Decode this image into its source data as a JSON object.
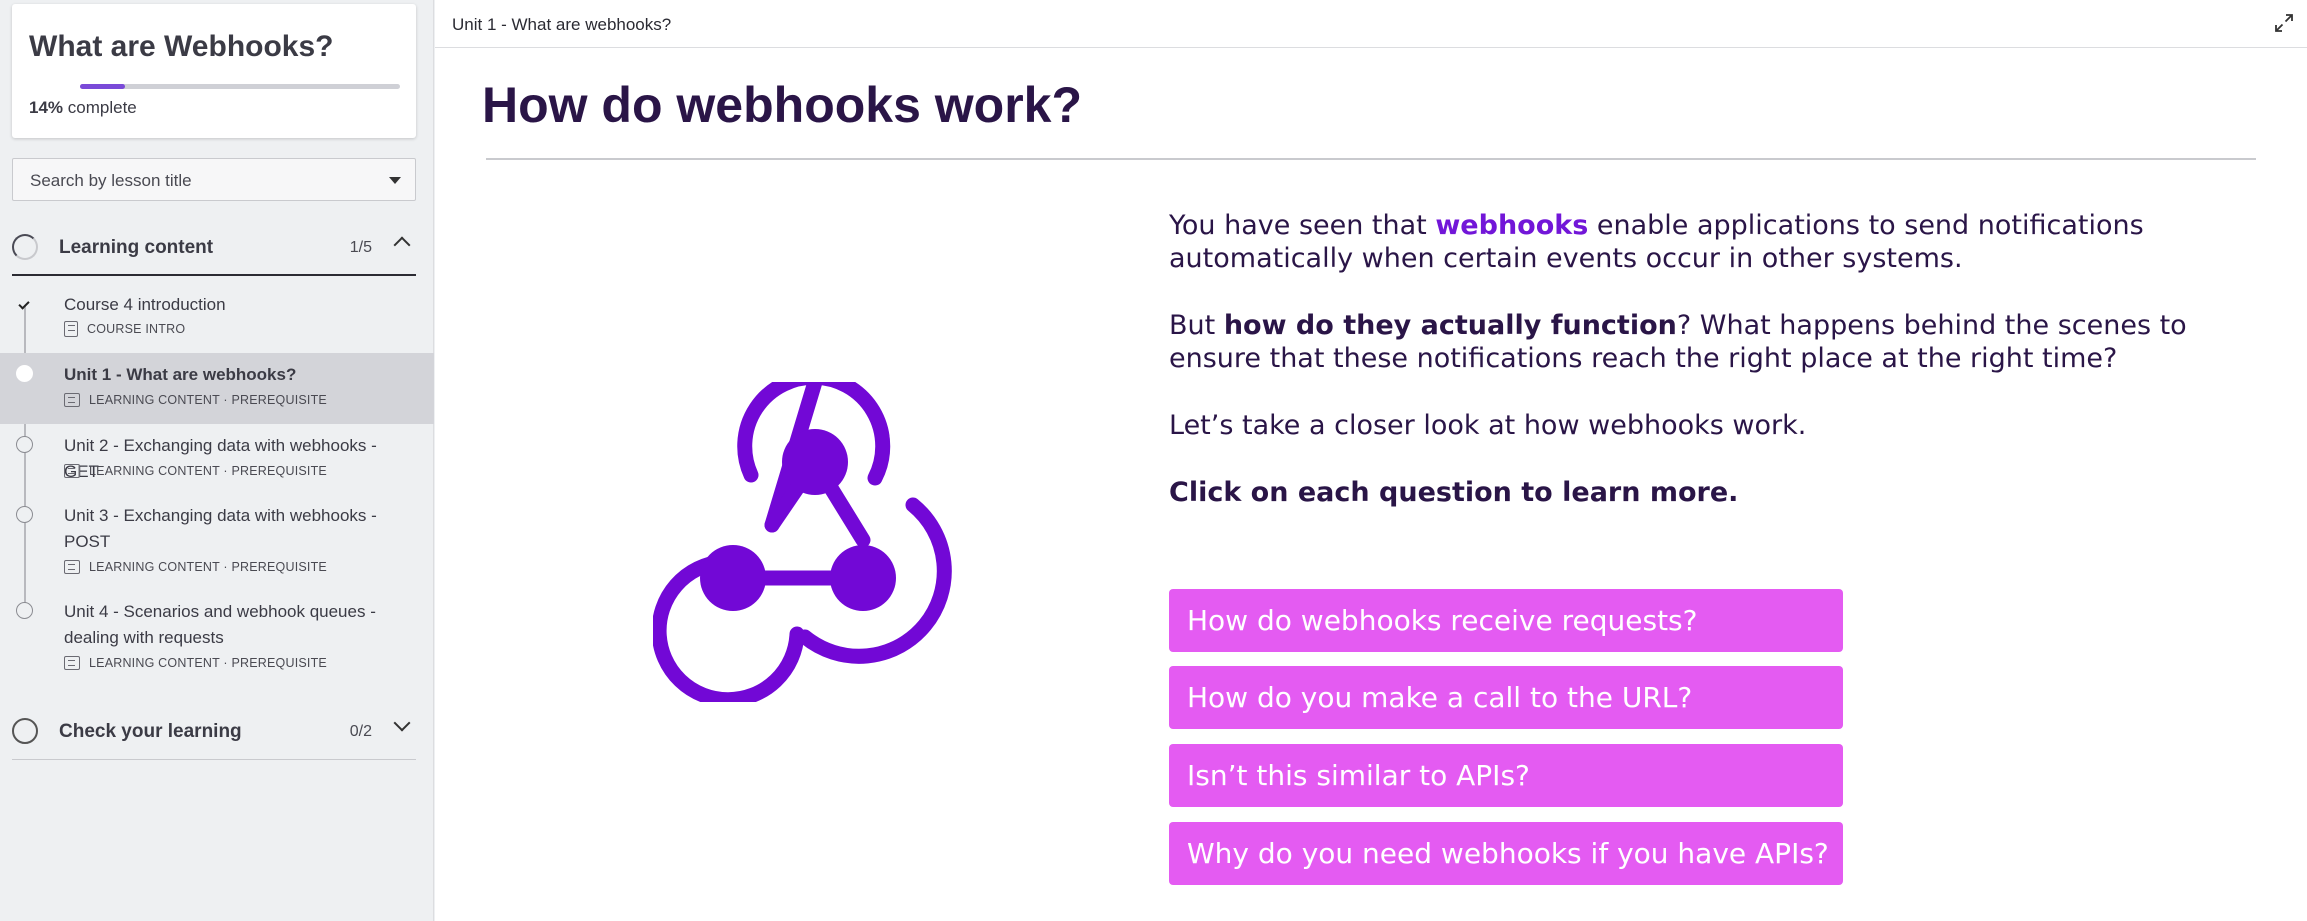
{
  "sidebar": {
    "course_title": "What are Webhooks?",
    "progress_percent": 14,
    "progress_label": "14%",
    "progress_suffix": "complete",
    "search_placeholder": "Search by lesson title",
    "sections": [
      {
        "title": "Learning content",
        "count": "1/5",
        "expanded": true,
        "lessons": [
          {
            "title": "Course 4 introduction",
            "meta": "COURSE INTRO",
            "status": "done"
          },
          {
            "title": "Unit 1 - What are webhooks?",
            "meta": "LEARNING CONTENT · PREREQUISITE",
            "status": "active"
          },
          {
            "title": "Unit 2 - Exchanging data with webhooks - GET",
            "meta": "LEARNING CONTENT · PREREQUISITE",
            "status": "todo"
          },
          {
            "title": "Unit 3 - Exchanging data with webhooks - POST",
            "meta": "LEARNING CONTENT · PREREQUISITE",
            "status": "todo"
          },
          {
            "title": "Unit 4 - Scenarios and webhook queues - dealing with requests",
            "meta": "LEARNING CONTENT · PREREQUISITE",
            "status": "todo"
          }
        ]
      },
      {
        "title": "Check your learning",
        "count": "0/2",
        "expanded": false
      }
    ]
  },
  "main": {
    "breadcrumb": "Unit 1 - What are webhooks?",
    "heading": "How do webhooks work?",
    "logo_icon": "webhooks-logo-icon",
    "paragraphs": {
      "p1_pre": "You have seen that ",
      "p1_hl": "webhooks",
      "p1_post": " enable applications to send notifications automatically when certain events occur in other systems.",
      "p2_pre": "But ",
      "p2_bold": "how do they actually function",
      "p2_post": "? What happens behind the scenes to ensure that these notifications reach the right place at the right time?",
      "p3": "Let’s take a closer look at how webhooks work.",
      "p4": "Click on each question to learn more."
    },
    "questions": [
      "How do webhooks receive requests?",
      "How do you make a call to the URL?",
      "Isn’t this similar to APIs?",
      "Why do you need webhooks if you have APIs?"
    ]
  },
  "colors": {
    "accent_purple": "#7216d8",
    "question_button": "#e45bf2",
    "heading_text": "#2a1547"
  }
}
